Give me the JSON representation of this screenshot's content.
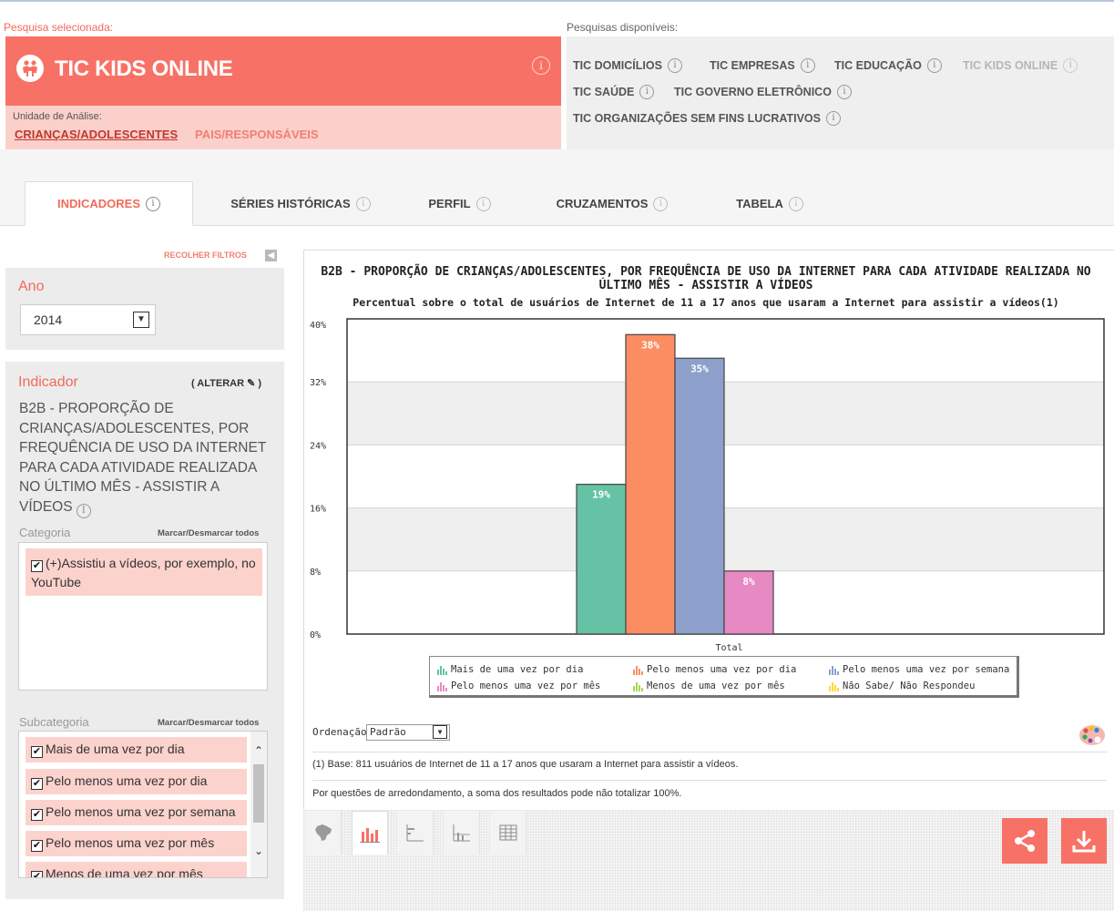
{
  "header": {
    "selected_label": "Pesquisa selecionada:",
    "selected_survey": "TIC KIDS ONLINE",
    "unit_label": "Unidade de Análise:",
    "unit_tabs": [
      "CRIANÇAS/ADOLESCENTES",
      "PAIS/RESPONSÁVEIS"
    ],
    "available_label": "Pesquisas disponíveis:",
    "available": [
      "TIC DOMICÍLIOS",
      "TIC EMPRESAS",
      "TIC EDUCAÇÃO",
      "TIC KIDS ONLINE",
      "TIC SAÚDE",
      "TIC GOVERNO ELETRÔNICO",
      "TIC ORGANIZAÇÕES SEM FINS LUCRATIVOS"
    ],
    "info_glyph": "i"
  },
  "tabs": [
    "INDICADORES",
    "SÉRIES HISTÓRICAS",
    "PERFIL",
    "CRUZAMENTOS",
    "TABELA"
  ],
  "sidebar": {
    "collapse_label": "RECOLHER FILTROS",
    "year_title": "Ano",
    "year_value": "2014",
    "indicator_title": "Indicador",
    "alter_label": "( ALTERAR",
    "alter_close": ")",
    "indicator_text": "B2B - PROPORÇÃO DE CRIANÇAS/ADOLESCENTES, POR FREQUÊNCIA DE USO DA INTERNET PARA CADA ATIVIDADE REALIZADA NO ÚLTIMO MÊS - ASSISTIR A VÍDEOS",
    "category_label": "Categoria",
    "mark_all": "Marcar/Desmarcar todos",
    "category_item": "(+)Assistiu a vídeos, por exemplo, no YouTube",
    "subcategory_label": "Subcategoria",
    "subcategories": [
      "Mais de uma vez por dia",
      "Pelo menos uma vez por dia",
      "Pelo menos uma vez por semana",
      "Pelo menos uma vez por mês",
      "Menos de uma vez por mês"
    ]
  },
  "main": {
    "ordering_label": "Ordenação:",
    "ordering_value": "Padrão",
    "note1": "(1) Base: 811 usuários de Internet de 11 a 17 anos que usaram a Internet para assistir a vídeos.",
    "note2": "Por questões de arredondamento, a soma dos resultados pode não totalizar 100%."
  },
  "colors": {
    "accent": "#f87166",
    "series": [
      "#66c2a5",
      "#fc8d62",
      "#8da0cb",
      "#e78ac3",
      "#a6d854",
      "#ffd92f"
    ]
  },
  "chart_data": {
    "type": "bar",
    "title": "B2B - PROPORÇÃO DE CRIANÇAS/ADOLESCENTES, POR FREQUÊNCIA DE USO DA INTERNET PARA CADA ATIVIDADE REALIZADA NO ÚLTIMO MÊS - ASSISTIR A VÍDEOS",
    "subtitle": "Percentual sobre o total de usuários de Internet de 11 a 17 anos que usaram a Internet para assistir a vídeos(1)",
    "categories": [
      "Total"
    ],
    "series": [
      {
        "name": "Mais de uma vez por dia",
        "values": [
          19
        ],
        "label": "19%"
      },
      {
        "name": "Pelo menos uma vez por dia",
        "values": [
          38
        ],
        "label": "38%"
      },
      {
        "name": "Pelo menos uma vez por semana",
        "values": [
          35
        ],
        "label": "35%"
      },
      {
        "name": "Pelo menos uma vez por mês",
        "values": [
          8
        ],
        "label": "8%"
      },
      {
        "name": "Menos de uma vez por mês",
        "values": [
          0
        ],
        "label": ""
      },
      {
        "name": "Não Sabe/ Não Respondeu",
        "values": [
          0
        ],
        "label": ""
      }
    ],
    "ylim": [
      0,
      40
    ],
    "yticks": [
      "0%",
      "8%",
      "16%",
      "24%",
      "32%",
      "40%"
    ],
    "grid": true,
    "legend": "bottom"
  }
}
